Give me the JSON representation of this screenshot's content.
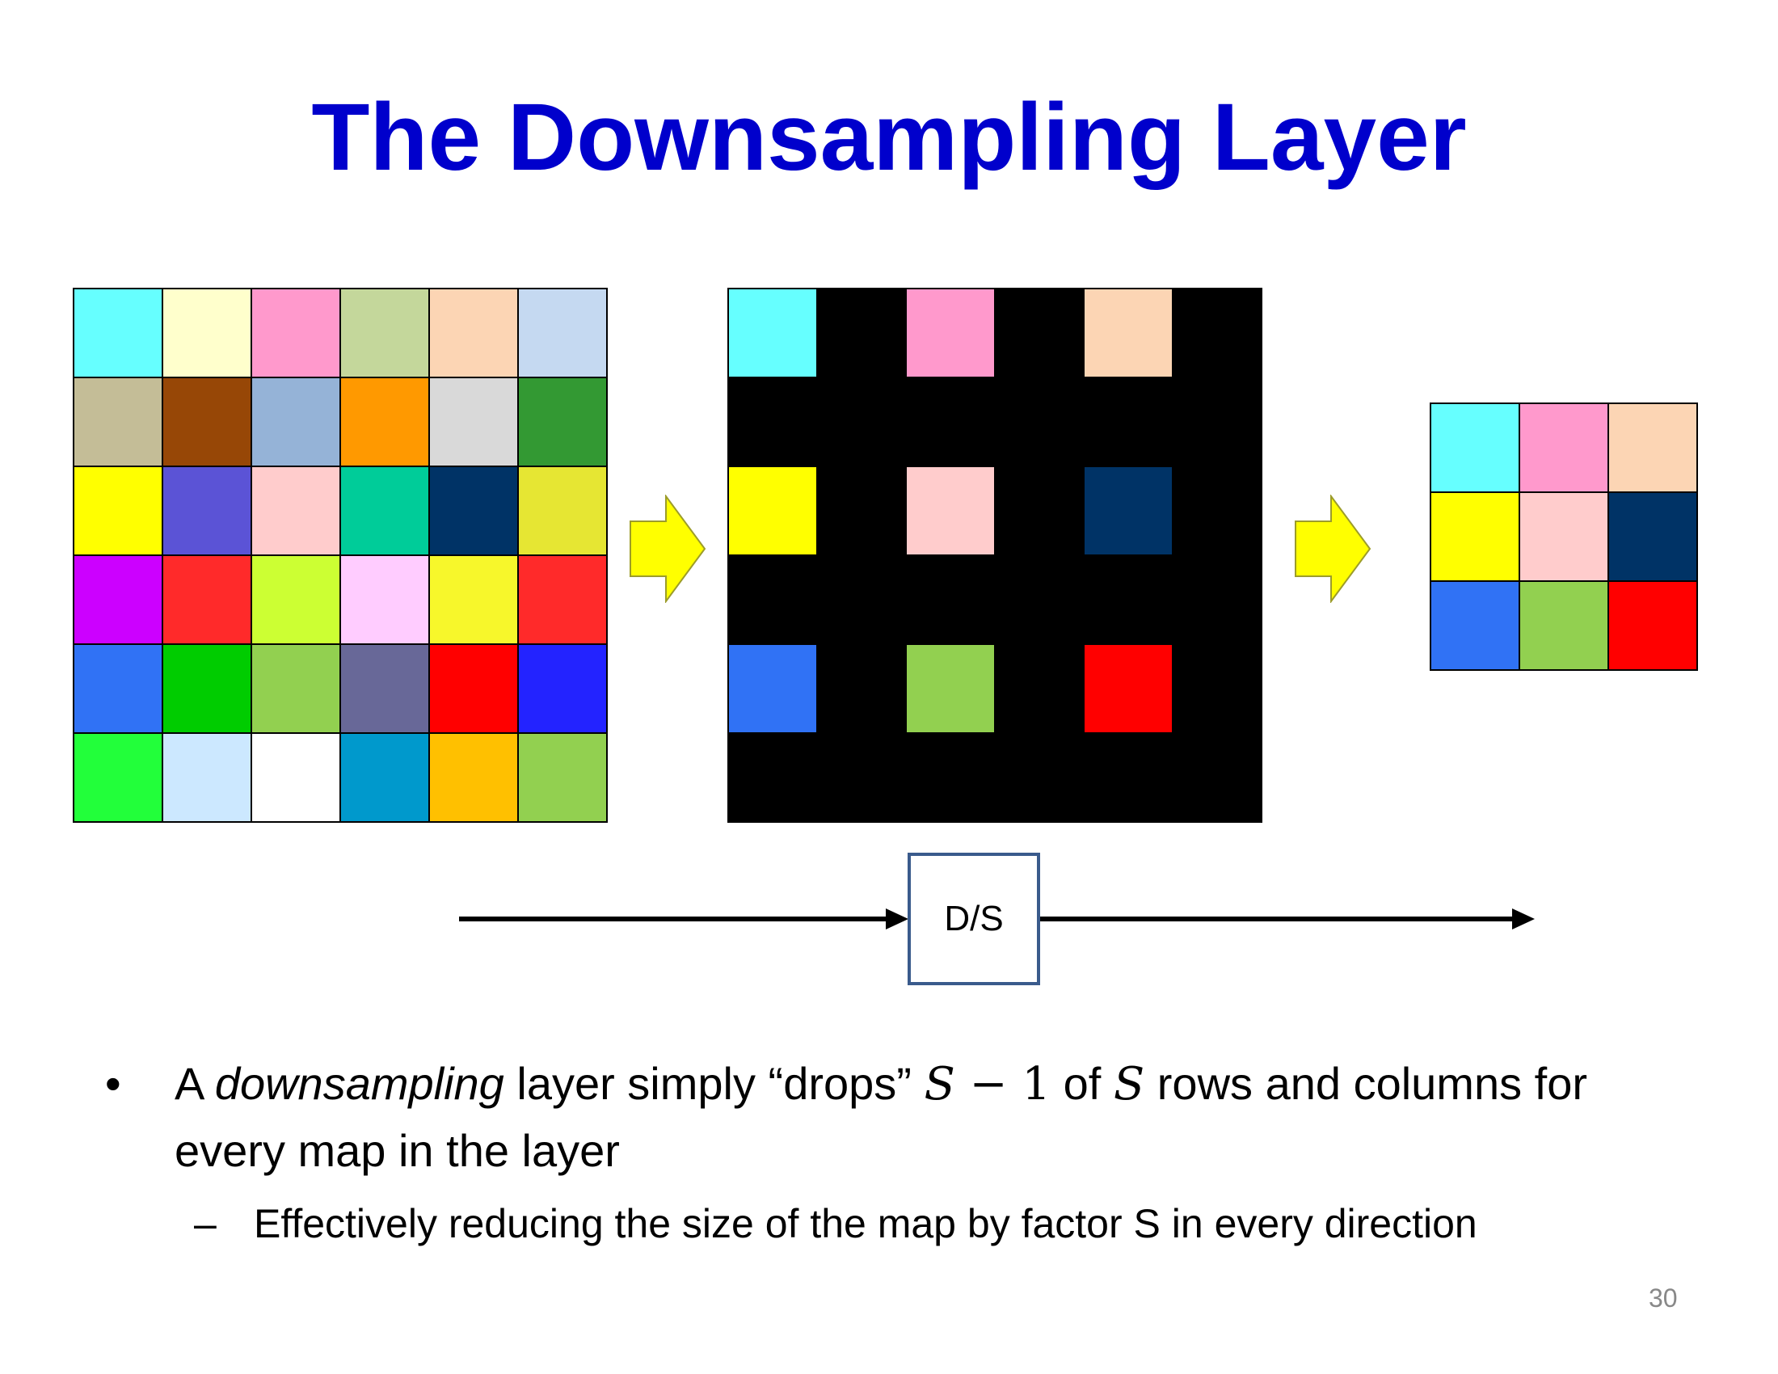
{
  "slide": {
    "title": "The Downsampling Layer",
    "page_number": "30"
  },
  "diagram": {
    "original_cells": [
      "#66ffff",
      "#ffffcc",
      "#ff99cc",
      "#c4d79b",
      "#fcd5b4",
      "#c5d9f1",
      "#c4bd97",
      "#974706",
      "#95b3d7",
      "#ff9900",
      "#d9d9d9",
      "#339933",
      "#ffff00",
      "#5b53d6",
      "#ffcccc",
      "#00cc99",
      "#003366",
      "#e6e633",
      "#cc00ff",
      "#ff2a2a",
      "#ccff33",
      "#ffccff",
      "#f7f72b",
      "#ff2a2a",
      "#3072f5",
      "#00cc00",
      "#92d050",
      "#686898",
      "#ff0000",
      "#2323ff",
      "#22ff3a",
      "#cce8ff",
      "#ffffff",
      "#0099cc",
      "#ffc000",
      "#92d050"
    ],
    "sampled_cells": [
      "#66ffff",
      "#000000",
      "#ff99cc",
      "#000000",
      "#fcd5b4",
      "#000000",
      "#000000",
      "#000000",
      "#000000",
      "#000000",
      "#000000",
      "#000000",
      "#ffff00",
      "#000000",
      "#ffcccc",
      "#000000",
      "#003366",
      "#000000",
      "#000000",
      "#000000",
      "#000000",
      "#000000",
      "#000000",
      "#000000",
      "#3072f5",
      "#000000",
      "#92d050",
      "#000000",
      "#ff0000",
      "#000000",
      "#000000",
      "#000000",
      "#000000",
      "#000000",
      "#000000",
      "#000000"
    ],
    "result_cells": [
      "#66ffff",
      "#ff99cc",
      "#fcd5b4",
      "#ffff00",
      "#ffcccc",
      "#003366",
      "#3072f5",
      "#92d050",
      "#ff0000"
    ],
    "block_arrow_color": "#ffff00",
    "block_arrow_outline": "#9c9c2a",
    "box_label": "D/S",
    "box_border_color": "#3a5b8c"
  },
  "bullets": [
    {
      "marker": "•",
      "text_a": "A ",
      "text_em": "downsampling",
      "text_b": " layer simply “drops” ",
      "math_s1": "S",
      "math_minus": " − 1",
      "text_c": " of ",
      "math_s2": "S",
      "text_d": " rows and columns for every map in the layer",
      "sub": {
        "marker": "–",
        "text": "Effectively reducing the size of the map by factor S in every direction"
      }
    }
  ]
}
